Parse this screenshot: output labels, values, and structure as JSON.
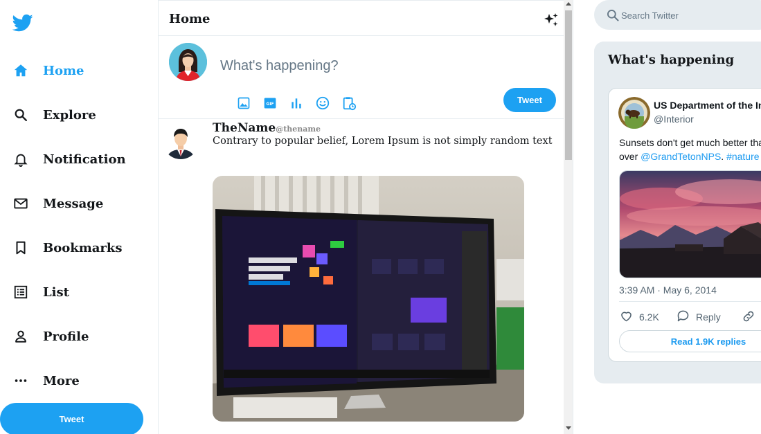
{
  "brand": {
    "accent": "#1da1f2",
    "logo_icon": "twitter-bird-icon"
  },
  "sidebar": {
    "items": [
      {
        "label": "Home",
        "icon": "home-icon",
        "active": true
      },
      {
        "label": "Explore",
        "icon": "search-icon"
      },
      {
        "label": "Notification",
        "icon": "bell-icon"
      },
      {
        "label": "Message",
        "icon": "mail-icon"
      },
      {
        "label": "Bookmarks",
        "icon": "bookmark-icon"
      },
      {
        "label": "List",
        "icon": "list-icon"
      },
      {
        "label": "Profile",
        "icon": "person-icon"
      },
      {
        "label": "More",
        "icon": "more-icon"
      }
    ],
    "tweet_button": "Tweet"
  },
  "feed": {
    "title": "Home",
    "composer": {
      "placeholder": "What's happening?",
      "tools": [
        "image-icon",
        "gif-icon",
        "poll-icon",
        "emoji-icon",
        "schedule-icon"
      ],
      "tweet_button": "Tweet"
    },
    "post": {
      "name": "TheName",
      "handle": "@thename",
      "text": "Contrary to popular belief, Lorem Ipsum is not simply random text"
    }
  },
  "right": {
    "search_placeholder": "Search Twitter",
    "trends_title": "What's happening",
    "embed": {
      "name": "US Department of the Int",
      "handle": "@Interior",
      "text_line1": "Sunsets don't get much better than",
      "text_line2_prefix": "over ",
      "mention": "@GrandTetonNPS",
      "text_sep": ". ",
      "hashtag": "#nature",
      "timestamp": "3:39 AM · May 6, 2014",
      "likes": "6.2K",
      "reply_label": "Reply",
      "copy_label": "C",
      "read_replies": "Read 1.9K replies"
    }
  }
}
